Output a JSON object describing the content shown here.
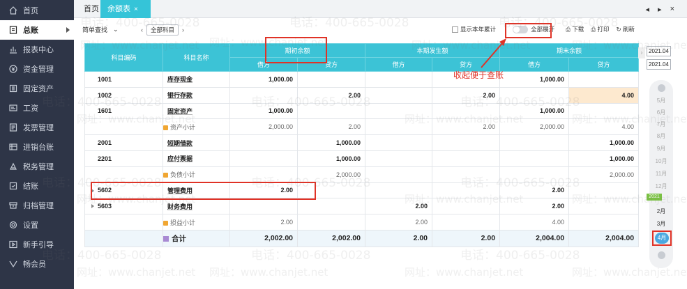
{
  "sidebar": {
    "items": [
      {
        "label": "首页",
        "icon": "home-icon"
      },
      {
        "label": "总账",
        "icon": "ledger-icon"
      },
      {
        "label": "报表中心",
        "icon": "chart-icon"
      },
      {
        "label": "资金管理",
        "icon": "money-icon"
      },
      {
        "label": "固定资产",
        "icon": "asset-icon"
      },
      {
        "label": "工资",
        "icon": "wage-icon"
      },
      {
        "label": "发票管理",
        "icon": "invoice-icon"
      },
      {
        "label": "进销台账",
        "icon": "stock-icon"
      },
      {
        "label": "税务管理",
        "icon": "tax-icon"
      },
      {
        "label": "结账",
        "icon": "close-book-icon"
      },
      {
        "label": "归档管理",
        "icon": "archive-icon"
      },
      {
        "label": "设置",
        "icon": "settings-icon"
      },
      {
        "label": "新手引导",
        "icon": "guide-icon"
      },
      {
        "label": "畅会员",
        "icon": "vip-icon"
      }
    ]
  },
  "tabs": {
    "home": "首页",
    "balance": "余额表",
    "close": "×"
  },
  "window": {
    "prev": "◂",
    "next": "▸",
    "close": "×"
  },
  "toolbar": {
    "simple_search": "简单查找",
    "all_subjects": "全部科目",
    "show_year_total": "显示本年累计",
    "expand_all": "全部展开",
    "download": "下载",
    "print": "打印",
    "refresh": "刷新"
  },
  "table": {
    "headers": {
      "code": "科目编码",
      "name": "科目名称",
      "opening": "期初余额",
      "period": "本期发生额",
      "closing": "期末余额",
      "debit": "借方",
      "credit": "贷方"
    },
    "rows": [
      {
        "type": "item",
        "code": "1001",
        "name": "库存现金",
        "od": "1,000.00",
        "oc": "",
        "pd": "",
        "pc": "",
        "cd": "1,000.00",
        "cc": ""
      },
      {
        "type": "item",
        "code": "1002",
        "name": "银行存款",
        "od": "",
        "oc": "2.00",
        "pd": "",
        "pc": "2.00",
        "cd": "",
        "cc": "4.00"
      },
      {
        "type": "item",
        "code": "1601",
        "name": "固定资产",
        "od": "1,000.00",
        "oc": "",
        "pd": "",
        "pc": "",
        "cd": "1,000.00",
        "cc": ""
      },
      {
        "type": "subtotal",
        "name": "资产小计",
        "od": "2,000.00",
        "oc": "2.00",
        "pd": "",
        "pc": "2.00",
        "cd": "2,000.00",
        "cc": "4.00"
      },
      {
        "type": "item",
        "code": "2001",
        "name": "短期借款",
        "od": "",
        "oc": "1,000.00",
        "pd": "",
        "pc": "",
        "cd": "",
        "cc": "1,000.00"
      },
      {
        "type": "item",
        "code": "2201",
        "name": "应付票据",
        "od": "",
        "oc": "1,000.00",
        "pd": "",
        "pc": "",
        "cd": "",
        "cc": "1,000.00"
      },
      {
        "type": "subtotal",
        "name": "负债小计",
        "od": "",
        "oc": "2,000.00",
        "pd": "",
        "pc": "",
        "cd": "",
        "cc": "2,000.00"
      },
      {
        "type": "item",
        "code": "5602",
        "name": "管理费用",
        "od": "2.00",
        "oc": "",
        "pd": "",
        "pc": "",
        "cd": "2.00",
        "cc": ""
      },
      {
        "type": "item",
        "code": "5603",
        "name": "财务费用",
        "od": "",
        "oc": "",
        "pd": "2.00",
        "pc": "",
        "cd": "2.00",
        "cc": ""
      },
      {
        "type": "subtotal",
        "name": "损益小计",
        "od": "2.00",
        "oc": "",
        "pd": "2.00",
        "pc": "",
        "cd": "4.00",
        "cc": ""
      },
      {
        "type": "total",
        "name": "合计",
        "od": "2,002.00",
        "oc": "2,002.00",
        "pd": "2.00",
        "pc": "2.00",
        "cd": "2,004.00",
        "cc": "2,004.00"
      }
    ]
  },
  "period_panel": {
    "from": "2021.04",
    "to": "2021.04",
    "months": [
      "5月",
      "6月",
      "7月",
      "8月",
      "9月",
      "10月",
      "11月",
      "12月",
      "2021",
      "2月",
      "3月",
      "4月"
    ],
    "year_tag": "2021"
  },
  "annotation": {
    "text": "收起便于查账",
    "color": "#e03226"
  },
  "watermark": {
    "phone": "电话：400-665-0028",
    "site": "网址：www.chanjet.net"
  }
}
